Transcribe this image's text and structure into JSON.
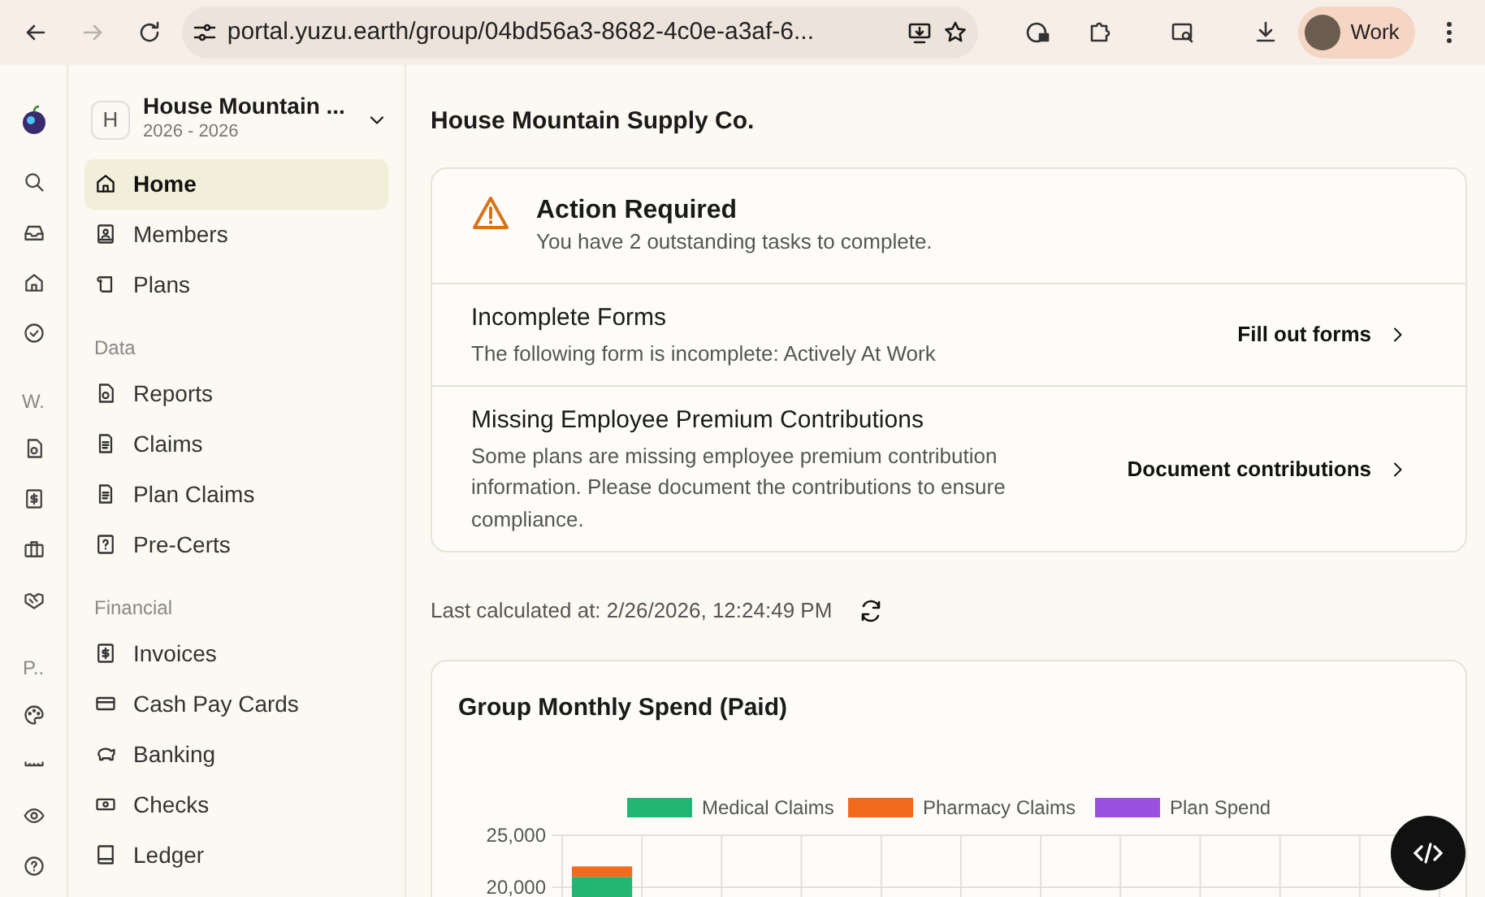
{
  "browser": {
    "url": "portal.yuzu.earth/group/04bd56a3-8682-4c0e-a3af-6...",
    "forward_disabled": true,
    "profile": "Work"
  },
  "rail": {
    "labels": [
      "W.",
      "P.."
    ]
  },
  "sidebar": {
    "org": {
      "initial": "H",
      "name": "House Mountain ...",
      "years": "2026 - 2026"
    },
    "sections": [
      {
        "items": [
          {
            "label": "Home",
            "selected": true
          },
          {
            "label": "Members",
            "selected": false
          },
          {
            "label": "Plans",
            "selected": false
          }
        ]
      },
      {
        "heading": "Data",
        "items": [
          {
            "label": "Reports",
            "selected": false
          },
          {
            "label": "Claims",
            "selected": false
          },
          {
            "label": "Plan Claims",
            "selected": false
          },
          {
            "label": "Pre-Certs",
            "selected": false
          }
        ]
      },
      {
        "heading": "Financial",
        "items": [
          {
            "label": "Invoices",
            "selected": false
          },
          {
            "label": "Cash Pay Cards",
            "selected": false
          },
          {
            "label": "Banking",
            "selected": false
          },
          {
            "label": "Checks",
            "selected": false
          },
          {
            "label": "Ledger",
            "selected": false
          }
        ]
      }
    ]
  },
  "page_title": "House Mountain Supply Co.",
  "action_card": {
    "title": "Action Required",
    "subtitle": "You have 2 outstanding tasks to complete.",
    "tasks": [
      {
        "title": "Incomplete Forms",
        "description": "The following form is incomplete: Actively At Work",
        "action": "Fill out forms"
      },
      {
        "title": "Missing Employee Premium Contributions",
        "description": "Some plans are missing employee premium contribution information. Please document the contributions to ensure compliance.",
        "action": "Document contributions"
      }
    ]
  },
  "last_calculated": "Last calculated at: 2/26/2026, 12:24:49 PM",
  "spend_card": {
    "title": "Group Monthly Spend (Paid)",
    "chart_data": {
      "type": "bar",
      "stacked": true,
      "legend": "top",
      "ylim": [
        0,
        25000
      ],
      "yticks": [
        {
          "value": 20000,
          "label": "20,000"
        },
        {
          "value": 25000,
          "label": "25,000"
        }
      ],
      "series": [
        {
          "name": "Medical Claims",
          "color": "#22b573",
          "values": [
            21000
          ]
        },
        {
          "name": "Pharmacy Claims",
          "color": "#f26b1d",
          "values": [
            1000
          ]
        },
        {
          "name": "Plan Spend",
          "color": "#9b51e0",
          "values": [
            null
          ]
        }
      ]
    }
  }
}
